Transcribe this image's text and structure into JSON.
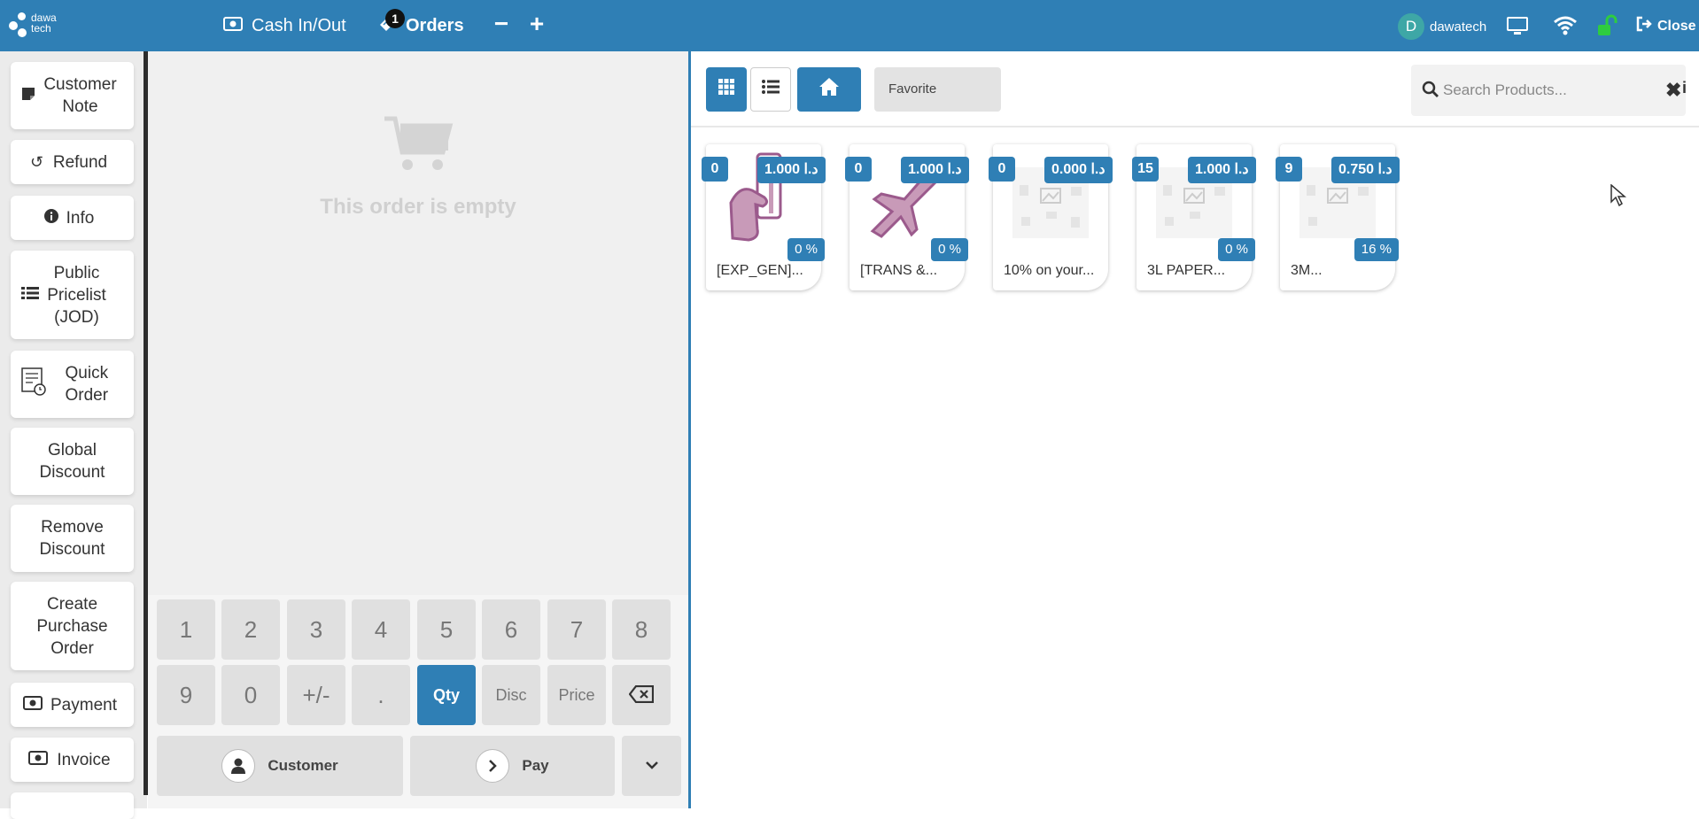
{
  "app": {
    "brand_line1": "dawa",
    "brand_line2": "tech",
    "brand_color": "#2f7fb5"
  },
  "topbar": {
    "cash_label": "Cash In/Out",
    "orders_label": "Orders",
    "orders_count": "1",
    "minus_label": "−",
    "plus_label": "+",
    "user_initial": "D",
    "user_name": "dawatech",
    "close_label": "Close"
  },
  "control_buttons": [
    {
      "label": "Customer Note",
      "icon": "note-icon"
    },
    {
      "label": "Refund",
      "icon": "undo-icon"
    },
    {
      "label": "Info",
      "icon": "info-icon"
    },
    {
      "label": "Public Pricelist (JOD)",
      "icon": "list-icon"
    },
    {
      "label": "Quick Order",
      "icon": "quick-order-icon"
    },
    {
      "label": "Global Discount",
      "icon": ""
    },
    {
      "label": "Remove Discount",
      "icon": ""
    },
    {
      "label": "Create Purchase Order",
      "icon": ""
    },
    {
      "label": "Payment",
      "icon": "money-icon"
    },
    {
      "label": "Invoice",
      "icon": "money-icon"
    }
  ],
  "order": {
    "empty_text": "This order is empty"
  },
  "numpad": {
    "keys_row1": [
      "1",
      "2",
      "3",
      "4",
      "5",
      "6",
      "7",
      "8"
    ],
    "keys_row2": [
      "9",
      "0",
      "+/-",
      ".",
      "Qty",
      "Disc",
      "Price",
      "backspace"
    ],
    "selected_mode": "Qty",
    "customer_label": "Customer",
    "pay_label": "Pay"
  },
  "products_bar": {
    "favorite_label": "Favorite",
    "search_placeholder": "Search Products..."
  },
  "products": [
    {
      "qty": "0",
      "price": "1.000 د.ا",
      "discount": "0 %",
      "name": "[EXP_GEN]...",
      "image": "hand-card-icon"
    },
    {
      "qty": "0",
      "price": "1.000 د.ا",
      "discount": "0 %",
      "name": "[TRANS &...",
      "image": "airplane-icon"
    },
    {
      "qty": "0",
      "price": "0.000 د.ا",
      "discount": "",
      "name": "10% on your...",
      "image": "placeholder-image-icon"
    },
    {
      "qty": "15",
      "price": "1.000 د.ا",
      "discount": "0 %",
      "name": "3L PAPER...",
      "image": "placeholder-image-icon"
    },
    {
      "qty": "9",
      "price": "0.750 د.ا",
      "discount": "16 %",
      "name": "3M...",
      "image": "placeholder-image-icon"
    }
  ]
}
